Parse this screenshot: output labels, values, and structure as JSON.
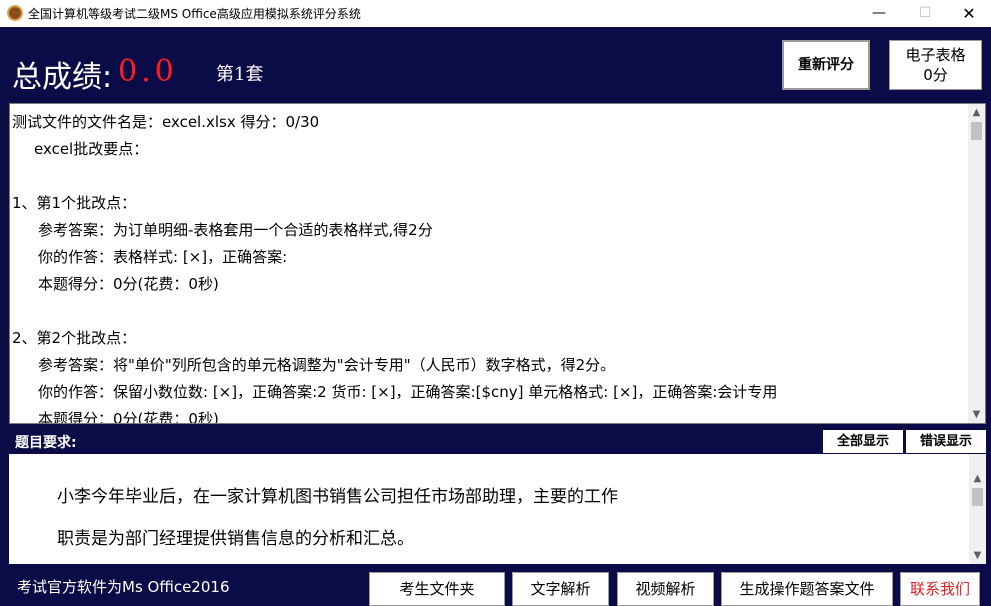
{
  "window": {
    "title": "全国计算机等级考试二级MS Office高级应用模拟系统评分系统",
    "minimize": "—",
    "maximize": "☐",
    "close": "✕"
  },
  "header": {
    "total_label": "总成绩:",
    "total_value": "0.0",
    "set_label": "第1套",
    "rescore_button": "重新评分",
    "excel_button_line1": "电子表格",
    "excel_button_line2": "0分"
  },
  "result": {
    "lines": [
      "测试文件的文件名是：excel.xlsx  得分：0/30",
      "excel批改要点：",
      "",
      "1、第1个批改点：",
      "参考答案：为订单明细-表格套用一个合适的表格样式,得2分",
      "你的作答：表格样式: [×]，正确答案:",
      "本题得分：0分(花费：0秒)",
      "",
      "2、第2个批改点：",
      "参考答案：将\"单价\"列所包含的单元格调整为\"会计专用\"（人民币）数字格式，得2分。",
      "你的作答：保留小数位数: [×]，正确答案:2  货币: [×]，正确答案:[$cny]  单元格格式: [×]，正确答案:会计专用",
      "本题得分：0分(花费：0秒)"
    ]
  },
  "requirements": {
    "title": "题目要求:",
    "tab_all": "全部显示",
    "tab_errors": "错误显示",
    "line1": "小李今年毕业后，在一家计算机图书销售公司担任市场部助理，主要的工作",
    "line2": "职责是为部门经理提供销售信息的分析和汇总。"
  },
  "footer": {
    "note": "考试官方软件为Ms Office2016",
    "folder_button": "考生文件夹",
    "text_button": "文字解析",
    "video_button": "视频解析",
    "generate_button": "生成操作题答案文件",
    "contact_button": "联系我们"
  },
  "colors": {
    "background": "#0b0b47",
    "score": "#ff1e1e",
    "contact": "#e02424"
  }
}
